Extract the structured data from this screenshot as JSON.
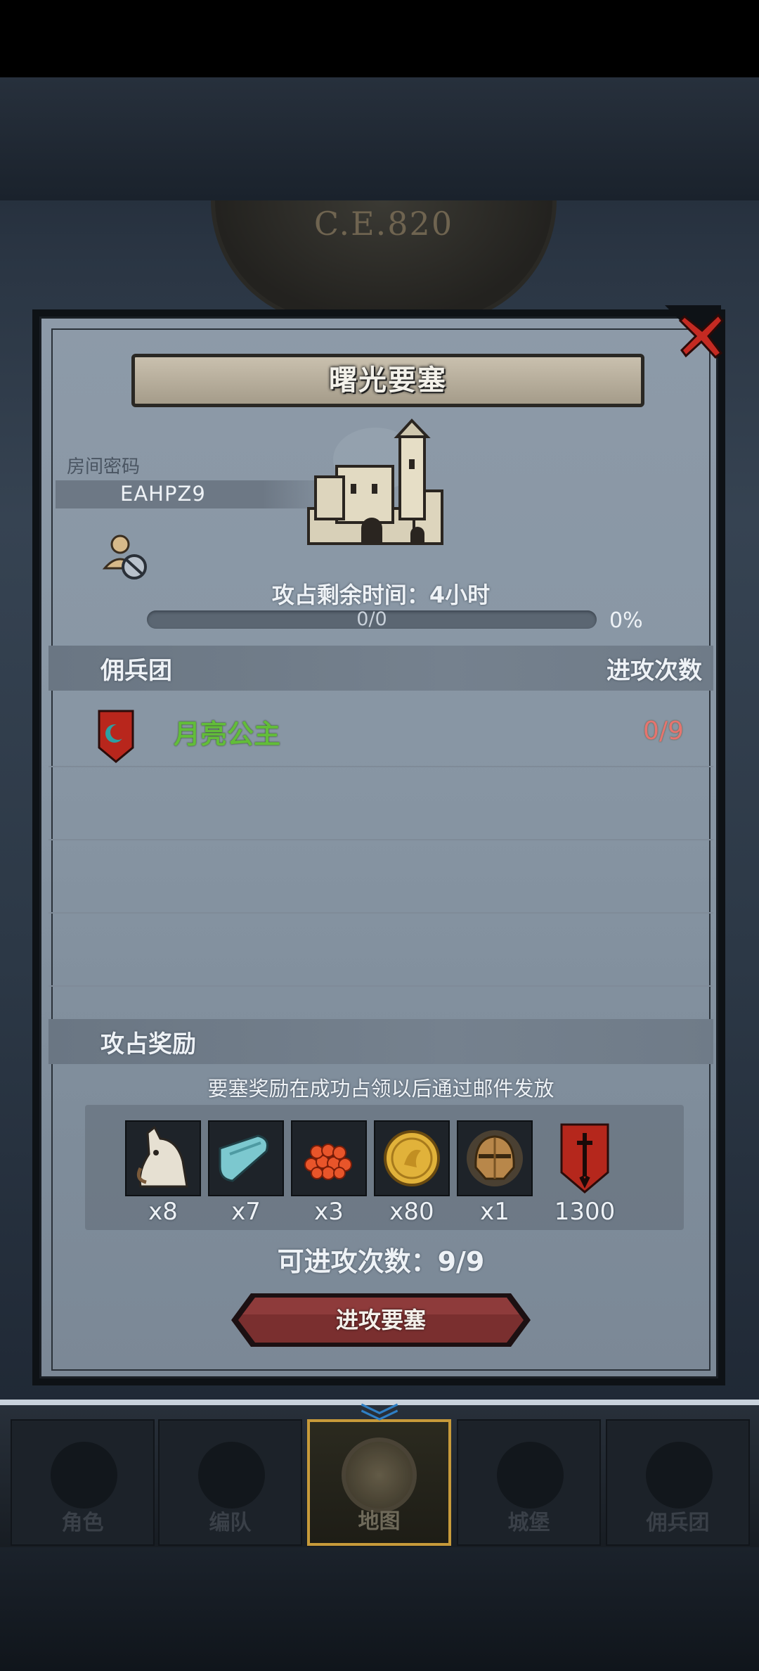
{
  "background": {
    "year": "C.E.820"
  },
  "dialog": {
    "title": "曙光要塞",
    "room": {
      "label": "房间密码",
      "code": "EAHPZ9"
    },
    "capture_time_label": "攻占剩余时间：4小时",
    "progress": {
      "text": "0/0",
      "percent_text": "0%",
      "value": 0
    },
    "mercenary_section": {
      "title": "佣兵团",
      "column_attacks": "进攻次数",
      "rows": [
        {
          "name": "月亮公主",
          "attacks": "0/9",
          "emblem_color": "#b8261c"
        }
      ]
    },
    "reward_section": {
      "title": "攻占奖励",
      "note": "要塞奖励在成功占领以后通过邮件发放",
      "rewards": [
        {
          "icon": "horse-icon",
          "count": "x8"
        },
        {
          "icon": "cloth-icon",
          "count": "x7"
        },
        {
          "icon": "caviar-icon",
          "count": "x3"
        },
        {
          "icon": "gold-coin-icon",
          "count": "x80"
        },
        {
          "icon": "helmet-icon",
          "count": "x1"
        },
        {
          "icon": "banner-sword-icon",
          "count": "1300"
        }
      ]
    },
    "attempts_label": "可进攻次数：9/9",
    "attack_button": "进攻要塞"
  },
  "bottom_nav": {
    "items": [
      {
        "label": "角色",
        "icon": "knight-icon",
        "active": false
      },
      {
        "label": "编队",
        "icon": "helmet-team-icon",
        "active": false
      },
      {
        "label": "地图",
        "icon": "map-globe-icon",
        "active": true
      },
      {
        "label": "城堡",
        "icon": "castle-icon",
        "active": false
      },
      {
        "label": "佣兵团",
        "icon": "mercenary-icon",
        "active": false
      }
    ]
  },
  "colors": {
    "merc_name": "#62bd39",
    "merc_attacks": "#e6746f",
    "attack_button": "#7a2f2f",
    "active_tab_border": "#c79a3a"
  }
}
